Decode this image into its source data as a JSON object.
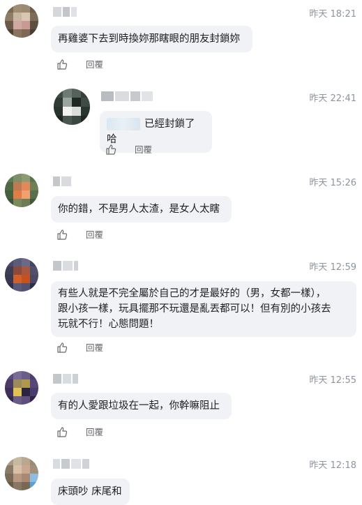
{
  "comments": [
    {
      "time": "昨天 18:21",
      "text": "再雞婆下去到時換妳那瞎眼的朋友封鎖妳",
      "reply_label": "回覆"
    },
    {
      "time": "昨天 22:41",
      "text": "已經封鎖了 哈",
      "reply_label": "回覆"
    },
    {
      "time": "昨天 15:26",
      "text": "你的錯，不是男人太渣，是女人太瞎",
      "reply_label": "回覆"
    },
    {
      "time": "昨天 12:59",
      "text_lines": [
        "有些人就是不完全屬於自己的才是最好的（男，女都一樣），",
        "跟小孩一樣，玩具擺那不玩還是亂丟都可以！但有別的小孩去",
        "玩就不行！心態問題！"
      ],
      "reply_label": "回覆"
    },
    {
      "time": "昨天 12:55",
      "text": "有的人愛跟垃圾在一起，你幹嘛阻止",
      "reply_label": "回覆"
    },
    {
      "time": "昨天 12:18",
      "text": "床頭吵 床尾和"
    }
  ],
  "colors": {
    "bubble_bg": "#f0f2f5",
    "meta_text": "#8d949e",
    "action_text": "#65676b"
  },
  "icons": {
    "like": "thumbs-up-icon"
  }
}
